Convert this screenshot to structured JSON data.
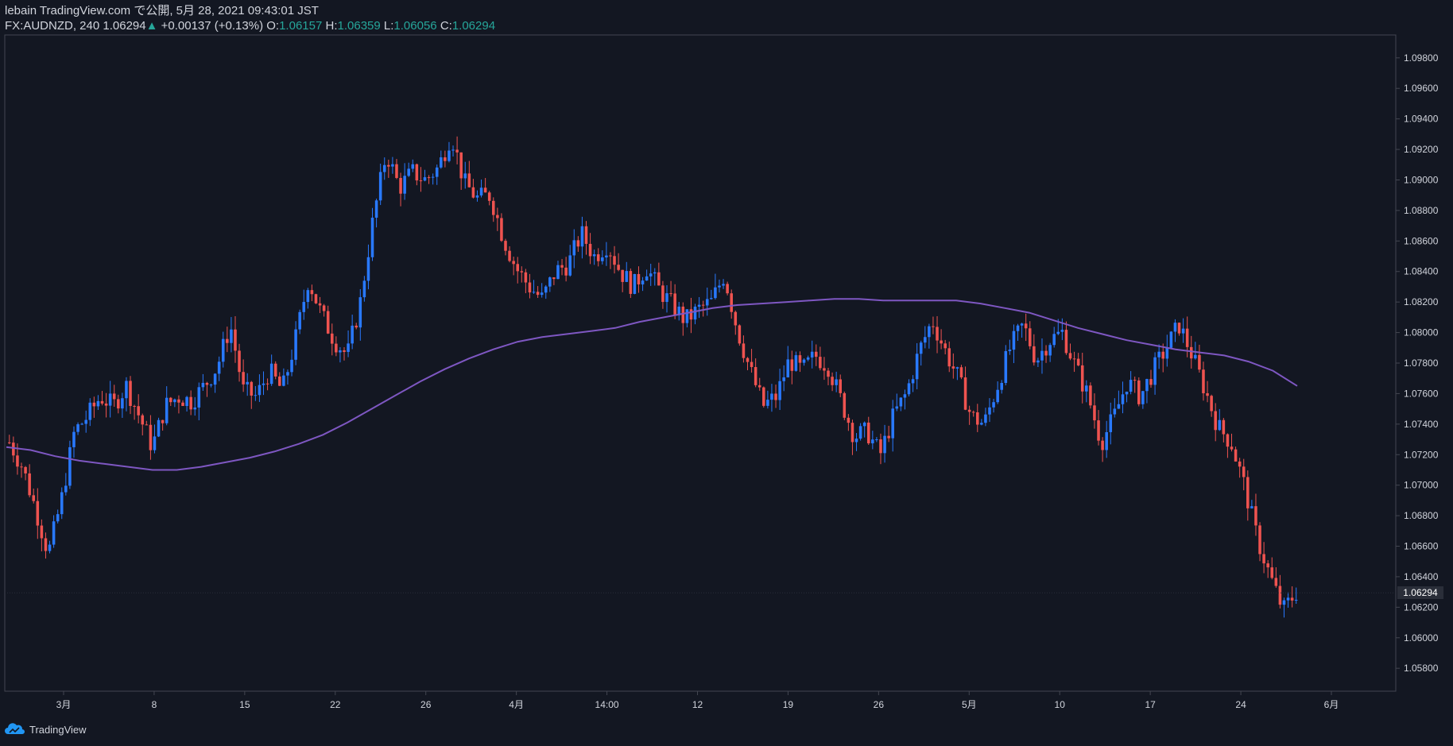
{
  "header": {
    "line1": "lebain TradingView.com で公開, 5月 28, 2021 09:43:01 JST",
    "symbol": "FX:AUDNZD, 240",
    "last": "1.06294",
    "change": "+0.00137 (+0.13%)",
    "o_label": "O:",
    "o": "1.06157",
    "h_label": "H:",
    "h": "1.06359",
    "l_label": "L:",
    "l": "1.06056",
    "c_label": "C:",
    "c": "1.06294"
  },
  "footer": {
    "brand": "TradingView",
    "logo_icon": "tradingview-cloud-icon"
  },
  "colors": {
    "background": "#131722",
    "up": "#2979ff",
    "down": "#ef5350",
    "ma": "#7e57c2",
    "text": "#d1d4dc"
  },
  "chart_data": {
    "type": "candlestick",
    "ylim": [
      1.0565,
      1.0995
    ],
    "y_ticks": [
      "1.09800",
      "1.09600",
      "1.09400",
      "1.09200",
      "1.09000",
      "1.08800",
      "1.08600",
      "1.08400",
      "1.08200",
      "1.08000",
      "1.07800",
      "1.07600",
      "1.07400",
      "1.07200",
      "1.07000",
      "1.06800",
      "1.06600",
      "1.06400",
      "1.06200",
      "1.06000",
      "1.05800"
    ],
    "x_ticks": [
      "3月",
      "8",
      "15",
      "22",
      "26",
      "4月",
      "14:00",
      "12",
      "19",
      "26",
      "5月",
      "10",
      "17",
      "24",
      "6月"
    ],
    "current_price": "1.06294",
    "anchors": [
      1.0728,
      1.0712,
      1.0685,
      1.0655,
      1.069,
      1.0735,
      1.0745,
      1.0758,
      1.0752,
      1.0765,
      1.0745,
      1.0725,
      1.0752,
      1.0758,
      1.0755,
      1.0765,
      1.0778,
      1.0805,
      1.0762,
      1.0758,
      1.0775,
      1.0762,
      1.0795,
      1.0835,
      1.0812,
      1.0795,
      1.0785,
      1.082,
      1.0875,
      1.0918,
      1.0895,
      1.0905,
      1.09,
      1.0908,
      1.093,
      1.0898,
      1.0888,
      1.089,
      1.0862,
      1.0842,
      1.083,
      1.0822,
      1.084,
      1.0845,
      1.0865,
      1.085,
      1.0858,
      1.084,
      1.083,
      1.0843,
      1.0828,
      1.0818,
      1.0808,
      1.0815,
      1.082,
      1.0838,
      1.0802,
      1.0775,
      1.0752,
      1.0758,
      1.0782,
      1.0775,
      1.0785,
      1.0778,
      1.0755,
      1.0732,
      1.0735,
      1.072,
      1.0745,
      1.076,
      1.0788,
      1.0808,
      1.0788,
      1.077,
      1.0745,
      1.074,
      1.0765,
      1.079,
      1.0805,
      1.0782,
      1.0795,
      1.08,
      1.0778,
      1.0758,
      1.0728,
      1.0745,
      1.0768,
      1.0758,
      1.0775,
      1.079,
      1.0805,
      1.0785,
      1.0762,
      1.0738,
      1.0728,
      1.07,
      1.0665,
      1.064,
      1.0618,
      1.063
    ],
    "ma_series": [
      1.0725,
      1.0723,
      1.0719,
      1.0716,
      1.0714,
      1.0712,
      1.071,
      1.071,
      1.0712,
      1.0715,
      1.0718,
      1.0722,
      1.0727,
      1.0733,
      1.0741,
      1.075,
      1.0759,
      1.0768,
      1.0776,
      1.0783,
      1.0789,
      1.0794,
      1.0797,
      1.0799,
      1.0801,
      1.0803,
      1.0807,
      1.081,
      1.0813,
      1.0816,
      1.0818,
      1.0819,
      1.082,
      1.0821,
      1.0822,
      1.0822,
      1.0821,
      1.0821,
      1.0821,
      1.0821,
      1.0819,
      1.0816,
      1.0813,
      1.0808,
      1.0803,
      1.0799,
      1.0795,
      1.0792,
      1.0789,
      1.0787,
      1.0785,
      1.0781,
      1.0775,
      1.0765
    ]
  }
}
